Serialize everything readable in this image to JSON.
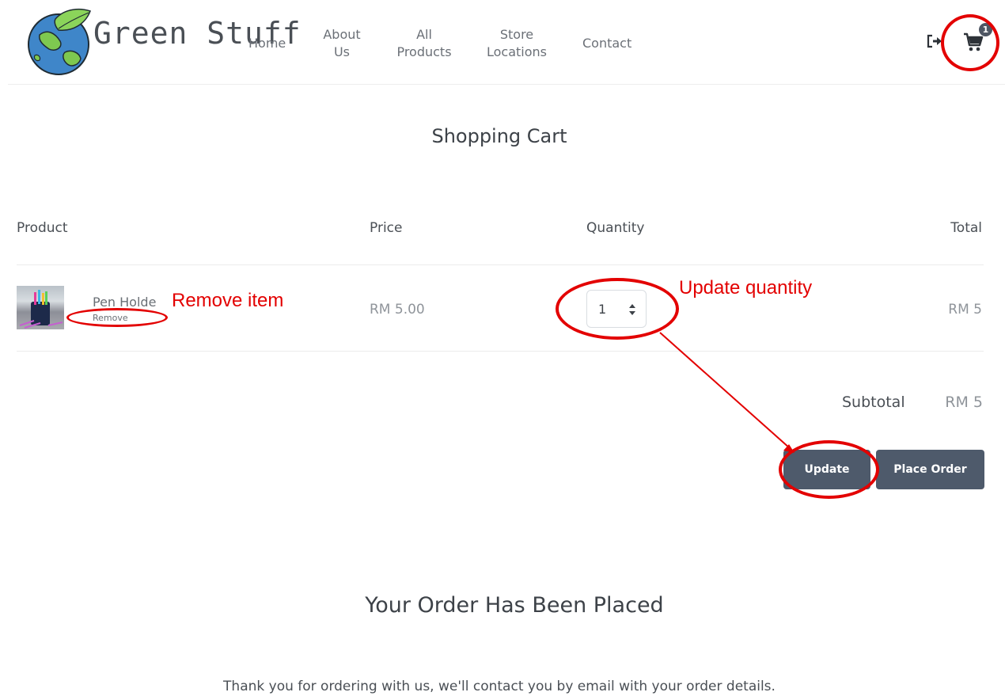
{
  "brand": {
    "name": "Green Stuff",
    "logo_icon": "globe-leaf-icon"
  },
  "nav": {
    "items": [
      {
        "label": "Home"
      },
      {
        "label": "About\nUs"
      },
      {
        "label": "All\nProducts"
      },
      {
        "label": "Store\nLocations"
      },
      {
        "label": "Contact"
      }
    ]
  },
  "header": {
    "logout_icon": "logout-icon",
    "cart_icon": "shopping-cart-icon",
    "cart_count": "1"
  },
  "cart": {
    "title": "Shopping Cart",
    "columns": [
      "Product",
      "Price",
      "Quantity",
      "Total"
    ],
    "items": [
      {
        "name": "Pen Holde",
        "remove_label": "Remove",
        "price": "RM 5.00",
        "quantity": "1",
        "total": "RM 5"
      }
    ],
    "subtotal_label": "Subtotal",
    "subtotal_value": "RM 5",
    "update_label": "Update",
    "place_order_label": "Place Order"
  },
  "confirmation": {
    "title": "Your Order Has Been Placed",
    "message": "Thank you for ordering with us, we'll contact you by email with your order details."
  },
  "annotations": {
    "remove_item": "Remove item",
    "update_quantity": "Update quantity",
    "color": "#e30000"
  },
  "colors": {
    "button_bg": "#4e5a6b",
    "text": "#4a4f55",
    "muted_text": "#8f949a"
  }
}
